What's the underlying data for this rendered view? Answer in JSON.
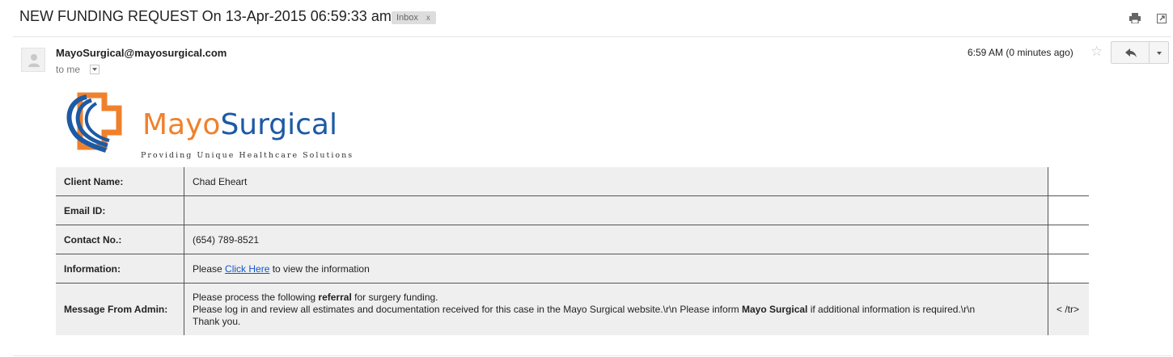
{
  "email": {
    "subject": "NEW FUNDING REQUEST On 13-Apr-2015 06:59:33 am",
    "label": "Inbox",
    "label_remove": "x",
    "sender": "MayoSurgical@mayosurgical.com",
    "recipient": "to me",
    "time": "6:59 AM (0 minutes ago)",
    "star": "☆"
  },
  "toolbar": {
    "print_icon": "print-icon",
    "new_window_icon": "new-window-icon",
    "reply_icon": "reply-icon"
  },
  "logo": {
    "name_part1": "Mayo",
    "name_part2": "Surgical",
    "tagline": "Providing Unique Healthcare Solutions",
    "colors": {
      "orange": "#f0812c",
      "blue": "#1d5aa5"
    }
  },
  "details": {
    "client_name_label": "Client Name:",
    "client_name_value": "Chad Eheart",
    "email_label": "Email ID:",
    "email_value": "",
    "contact_label": "Contact No.:",
    "contact_value": "(654) 789-8521",
    "information_label": "Information:",
    "info_prefix": "Please ",
    "info_link": "Click Here",
    "info_suffix": " to view the information",
    "message_label": "Message From Admin:",
    "message_line1_a": "Please process the following ",
    "message_line1_b": "referral",
    "message_line1_c": " for surgery funding.",
    "message_line2_a": "Please log in and review all estimates and documentation received for this case in the Mayo Surgical website.\\r\\n Please inform ",
    "message_line2_b": "Mayo Surgical",
    "message_line2_c": " if additional information is required.\\r\\n",
    "message_line3": "Thank you.",
    "stray_tag": "< /tr>"
  }
}
